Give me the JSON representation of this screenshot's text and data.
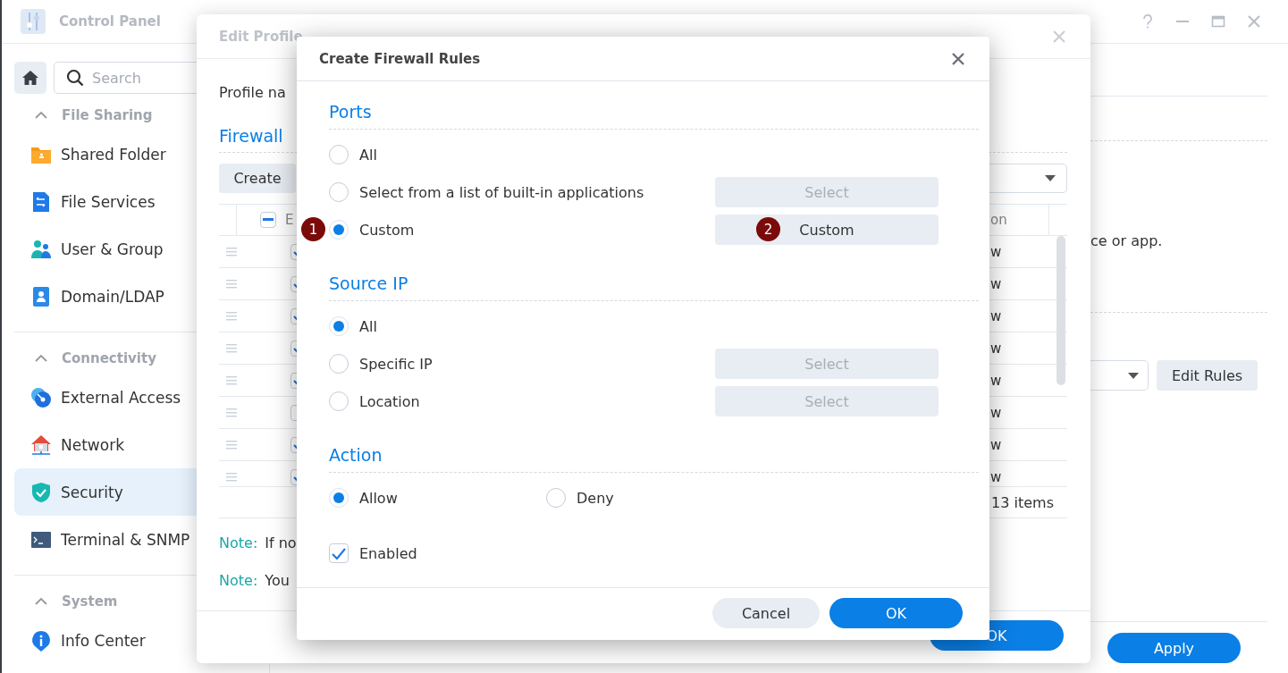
{
  "control_panel": {
    "title": "Control Panel",
    "search": {
      "placeholder": "Search"
    },
    "sidebar": {
      "groups": [
        {
          "label": "File Sharing",
          "expanded": true,
          "items": [
            {
              "label": "Shared Folder",
              "selected": false
            },
            {
              "label": "File Services",
              "selected": false
            },
            {
              "label": "User & Group",
              "selected": false
            },
            {
              "label": "Domain/LDAP",
              "selected": false
            }
          ]
        },
        {
          "label": "Connectivity",
          "expanded": true,
          "items": [
            {
              "label": "External Access",
              "selected": false
            },
            {
              "label": "Network",
              "selected": false
            },
            {
              "label": "Security",
              "selected": true
            },
            {
              "label": "Terminal & SNMP",
              "selected": false
            }
          ]
        },
        {
          "label": "System",
          "expanded": true,
          "items": [
            {
              "label": "Info Center",
              "selected": false
            }
          ]
        }
      ]
    },
    "content": {
      "text": "ce or app.",
      "button": "Edit Rules",
      "footer_button": "Apply"
    }
  },
  "edit_profile": {
    "title": "Edit Profile",
    "field_label": "Profile na",
    "section": "Firewall",
    "create_button": "Create",
    "table": {
      "select_all_indeterminate": true,
      "columns": [
        "E",
        "on"
      ],
      "rows": [
        {
          "enabled": true,
          "action": "w"
        },
        {
          "enabled": true,
          "action": "w"
        },
        {
          "enabled": true,
          "action": "w"
        },
        {
          "enabled": true,
          "action": "w"
        },
        {
          "enabled": true,
          "action": "w"
        },
        {
          "enabled": false,
          "action": "w"
        },
        {
          "enabled": true,
          "action": "w"
        },
        {
          "enabled": true,
          "action": "w"
        }
      ],
      "footer": "13 items"
    },
    "notes": [
      {
        "label": "Note:",
        "text": "If no"
      },
      {
        "label": "Note:",
        "text": "You"
      }
    ],
    "ok_button": "OK"
  },
  "dialog": {
    "title": "Create Firewall Rules",
    "sections": [
      {
        "heading": "Ports",
        "kind": "list",
        "options": [
          {
            "label": "All",
            "selected": false
          },
          {
            "label": "Select from a list of built-in applications",
            "selected": false,
            "button": "Select",
            "disabled": true
          },
          {
            "label": "Custom",
            "selected": true,
            "badge": "1",
            "button": "Custom",
            "disabled": false,
            "button_badge": "2"
          }
        ]
      },
      {
        "heading": "Source IP",
        "kind": "list",
        "options": [
          {
            "label": "All",
            "selected": true
          },
          {
            "label": "Specific IP",
            "selected": false,
            "button": "Select",
            "disabled": true
          },
          {
            "label": "Location",
            "selected": false,
            "button": "Select",
            "disabled": true
          }
        ]
      },
      {
        "heading": "Action",
        "kind": "row",
        "options": [
          {
            "label": "Allow",
            "selected": true
          },
          {
            "label": "Deny",
            "selected": false
          }
        ]
      }
    ],
    "enabled": {
      "label": "Enabled",
      "checked": true
    },
    "buttons": [
      {
        "label": "Cancel",
        "kind": "secondary"
      },
      {
        "label": "OK",
        "kind": "primary"
      }
    ]
  }
}
